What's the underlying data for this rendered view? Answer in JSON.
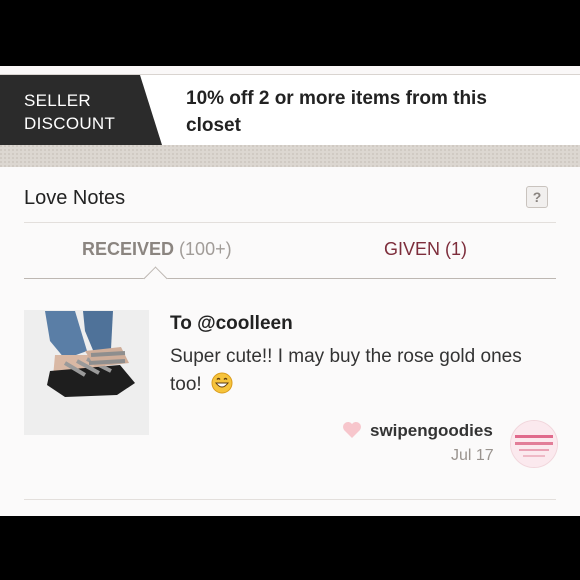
{
  "banner": {
    "badge_line1": "SELLER",
    "badge_line2": "DISCOUNT",
    "message": "10% off 2 or more items from this closet"
  },
  "love_notes": {
    "title": "Love Notes",
    "help_label": "?",
    "tabs": [
      {
        "label": "RECEIVED",
        "count": "(100+)",
        "active": true
      },
      {
        "label": "GIVEN (1)",
        "active": false
      }
    ],
    "note": {
      "to": "To @coolleen",
      "message": "Super cute!! I may buy the rose gold ones too!",
      "emoji": "grinning-face-icon",
      "from": "swipengoodies",
      "date": "Jul 17"
    }
  },
  "colors": {
    "badge_bg": "#2b2b2b",
    "given_tab": "#7d2d3b",
    "heart": "#f7c6cc"
  }
}
